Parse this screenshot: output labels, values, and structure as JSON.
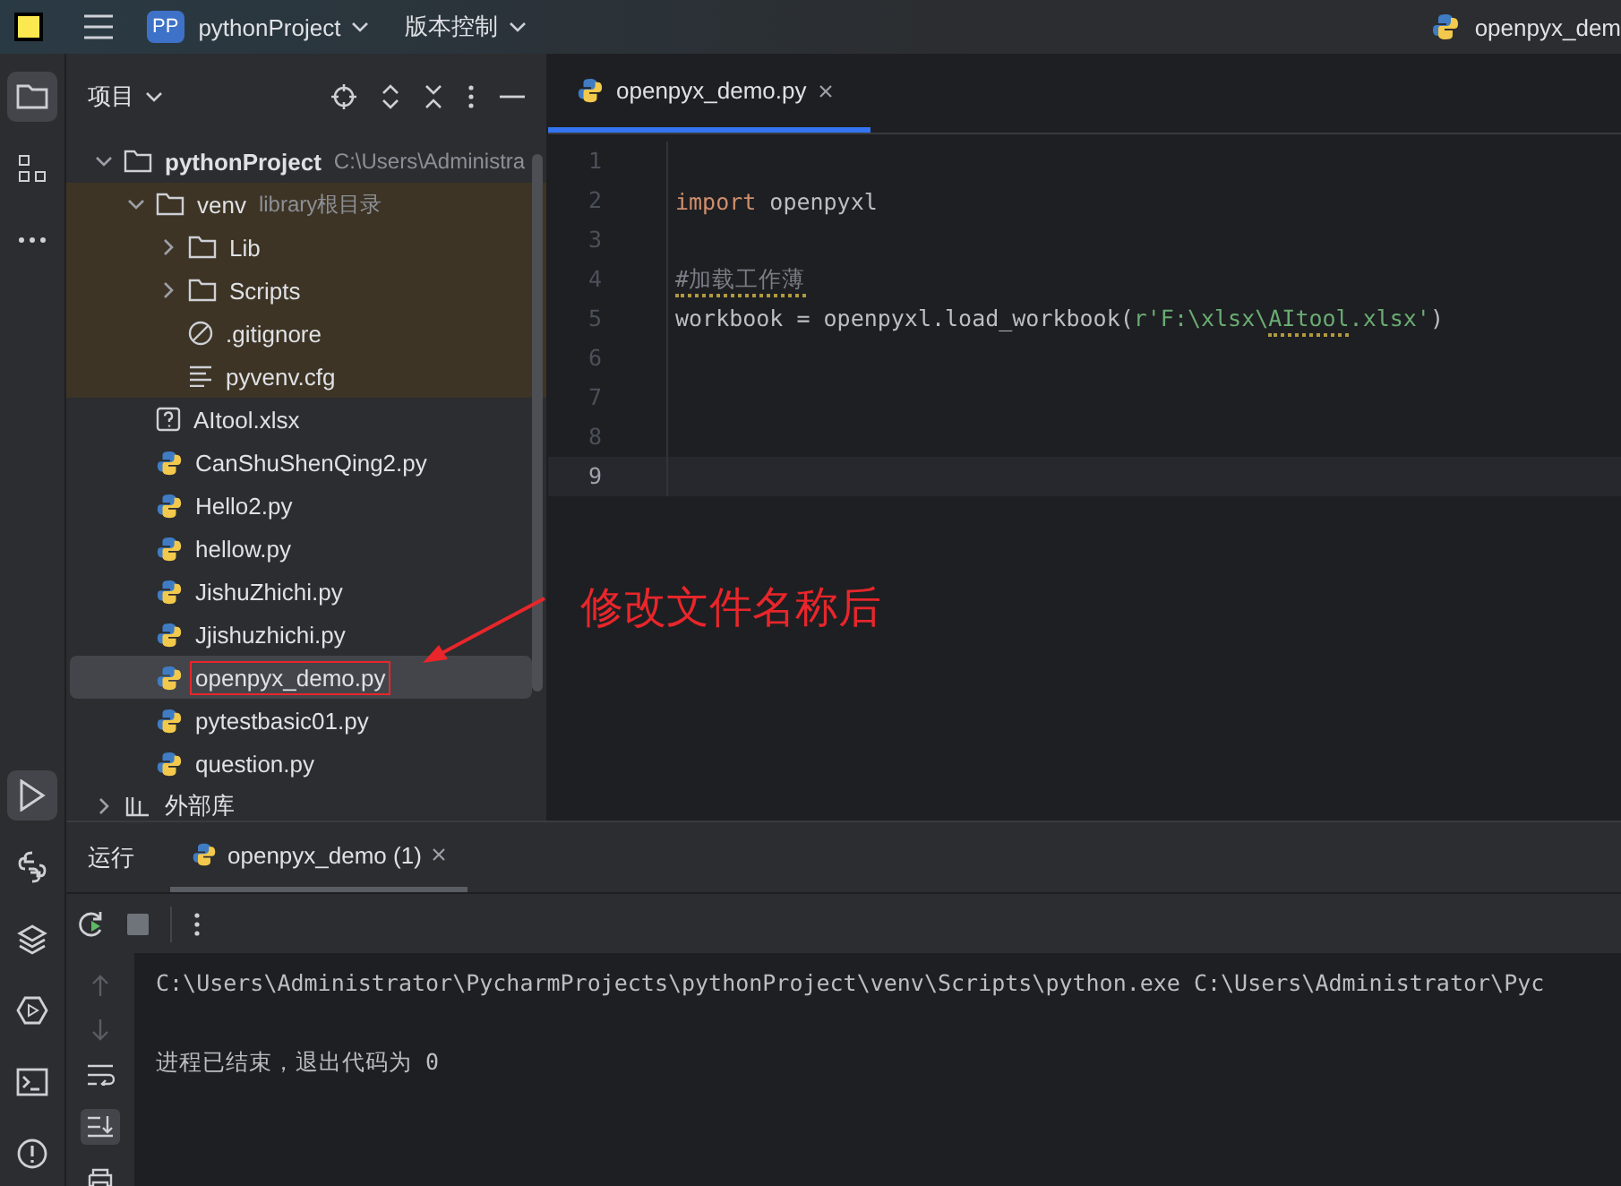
{
  "title_bar": {
    "project_badge": "PP",
    "project": "pythonProject",
    "vcs": "版本控制",
    "current_file": "openpyx_dem"
  },
  "project_panel": {
    "title": "项目",
    "tree": [
      {
        "name": "pythonProject",
        "hint": "C:\\Users\\Administra",
        "kind": "folder",
        "expanded": true,
        "highlighted": false,
        "selected": false,
        "bold": true,
        "children": [
          {
            "name": "venv",
            "hint": "library根目录",
            "kind": "folder",
            "expanded": true,
            "highlighted": true,
            "selected": false,
            "children": [
              {
                "name": "Lib",
                "kind": "folder",
                "expanded": false,
                "highlighted": true,
                "selected": false
              },
              {
                "name": "Scripts",
                "kind": "folder",
                "expanded": false,
                "highlighted": true,
                "selected": false
              },
              {
                "name": ".gitignore",
                "kind": "ignore",
                "highlighted": true,
                "selected": false
              },
              {
                "name": "pyvenv.cfg",
                "kind": "text",
                "highlighted": true,
                "selected": false
              }
            ]
          },
          {
            "name": "AItool.xlsx",
            "kind": "unknown",
            "highlighted": false,
            "selected": false
          },
          {
            "name": "CanShuShenQing2.py",
            "kind": "python",
            "highlighted": false,
            "selected": false
          },
          {
            "name": "Hello2.py",
            "kind": "python",
            "highlighted": false,
            "selected": false
          },
          {
            "name": "hellow.py",
            "kind": "python",
            "highlighted": false,
            "selected": false
          },
          {
            "name": "JishuZhichi.py",
            "kind": "python",
            "highlighted": false,
            "selected": false
          },
          {
            "name": "Jjishuzhichi.py",
            "kind": "python",
            "highlighted": false,
            "selected": false
          },
          {
            "name": "openpyx_demo.py",
            "kind": "python",
            "highlighted": false,
            "selected": true,
            "boxed": true
          },
          {
            "name": "pytestbasic01.py",
            "kind": "python",
            "highlighted": false,
            "selected": false
          },
          {
            "name": "question.py",
            "kind": "python",
            "highlighted": false,
            "selected": false
          }
        ]
      },
      {
        "name": "外部库",
        "kind": "library",
        "expanded": false,
        "highlighted": false,
        "selected": false
      }
    ]
  },
  "editor": {
    "tabs": [
      {
        "label": "openpyx_demo.py",
        "selected": true
      }
    ],
    "lines": [
      {
        "number": "1",
        "current": false
      },
      {
        "number": "2",
        "current": false,
        "tokens": [
          {
            "text": "import",
            "kind": "keyword"
          },
          {
            "text": " openpyxl",
            "kind": "plain"
          }
        ]
      },
      {
        "number": "3",
        "current": false
      },
      {
        "number": "4",
        "current": false,
        "tokens": [
          {
            "text": "#加载工作薄",
            "kind": "comment",
            "squiggle": true
          }
        ]
      },
      {
        "number": "5",
        "current": false,
        "tokens": [
          {
            "text": "workbook = openpyxl.load_workbook(",
            "kind": "plain"
          },
          {
            "text": "r'F:\\xlsx\\",
            "kind": "string"
          },
          {
            "text": "AItool",
            "kind": "string",
            "squiggle": true
          },
          {
            "text": ".xlsx'",
            "kind": "string"
          },
          {
            "text": ")",
            "kind": "plain"
          }
        ]
      },
      {
        "number": "6",
        "current": false
      },
      {
        "number": "7",
        "current": false
      },
      {
        "number": "8",
        "current": false
      },
      {
        "number": "9",
        "current": true
      }
    ],
    "annotation": "修改文件名称后"
  },
  "run_panel": {
    "label": "运行",
    "tabs": [
      {
        "label": "openpyx_demo (1)",
        "selected": true
      }
    ],
    "output": [
      {
        "text": "C:\\Users\\Administrator\\PycharmProjects\\pythonProject\\venv\\Scripts\\python.exe C:\\Users\\Administrator\\Pyc"
      },
      {
        "text": "进程已结束，退出代码为 0"
      }
    ]
  }
}
